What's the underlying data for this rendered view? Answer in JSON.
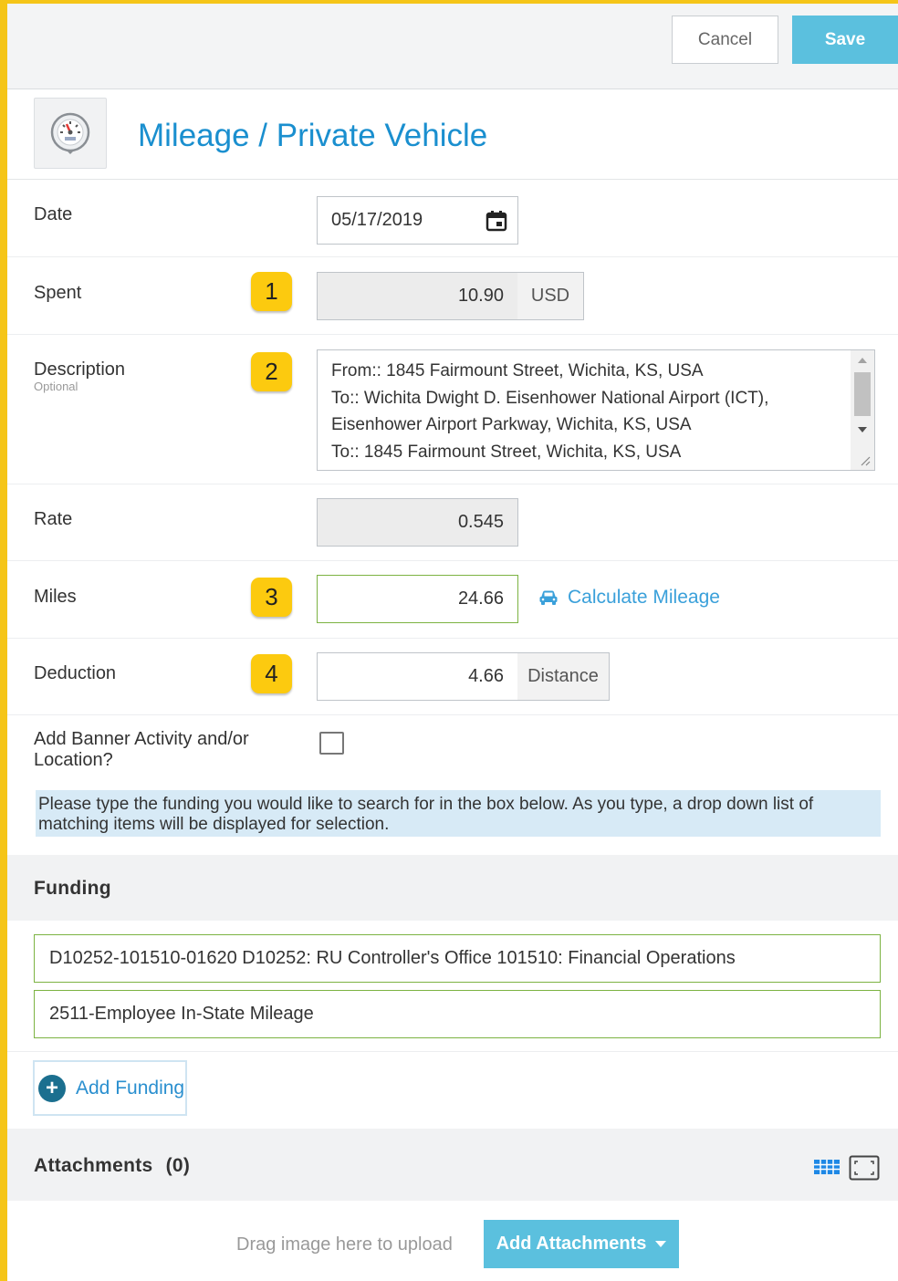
{
  "toolbar": {
    "cancel_label": "Cancel",
    "save_label": "Save"
  },
  "header": {
    "title": "Mileage / Private Vehicle",
    "icon": "speedometer-icon"
  },
  "form": {
    "date": {
      "label": "Date",
      "value": "05/17/2019"
    },
    "spent": {
      "label": "Spent",
      "badge": "1",
      "value": "10.90",
      "currency": "USD"
    },
    "description": {
      "label": "Description",
      "sublabel": "Optional",
      "badge": "2",
      "lines": [
        "From:: 1845 Fairmount Street, Wichita, KS, USA",
        "To:: Wichita Dwight D. Eisenhower National Airport (ICT),",
        "Eisenhower Airport Parkway, Wichita, KS, USA",
        "To:: 1845 Fairmount Street, Wichita, KS, USA"
      ]
    },
    "rate": {
      "label": "Rate",
      "value": "0.545"
    },
    "miles": {
      "label": "Miles",
      "badge": "3",
      "value": "24.66",
      "calc_label": "Calculate Mileage"
    },
    "deduction": {
      "label": "Deduction",
      "badge": "4",
      "value": "4.66",
      "unit": "Distance"
    },
    "banner": {
      "label": "Add Banner Activity and/or Location?",
      "checked": false
    }
  },
  "info_text": "Please type the funding you would like to search for in the box below. As you type, a drop down list of matching items will be displayed for selection.",
  "funding": {
    "title": "Funding",
    "fields": [
      "D10252-101510-01620 D10252: RU  Controller's Office 101510: Financial Operations",
      "2511-Employee In-State Mileage"
    ],
    "add_label": "Add Funding"
  },
  "attachments": {
    "title": "Attachments",
    "count": "(0)",
    "drag_text": "Drag image here to upload",
    "add_label": "Add Attachments"
  },
  "colors": {
    "accent": "#5bc0de",
    "title": "#1a8fcf",
    "badge": "#fcca0f",
    "frame": "#f5c518",
    "valid": "#7cb342"
  }
}
